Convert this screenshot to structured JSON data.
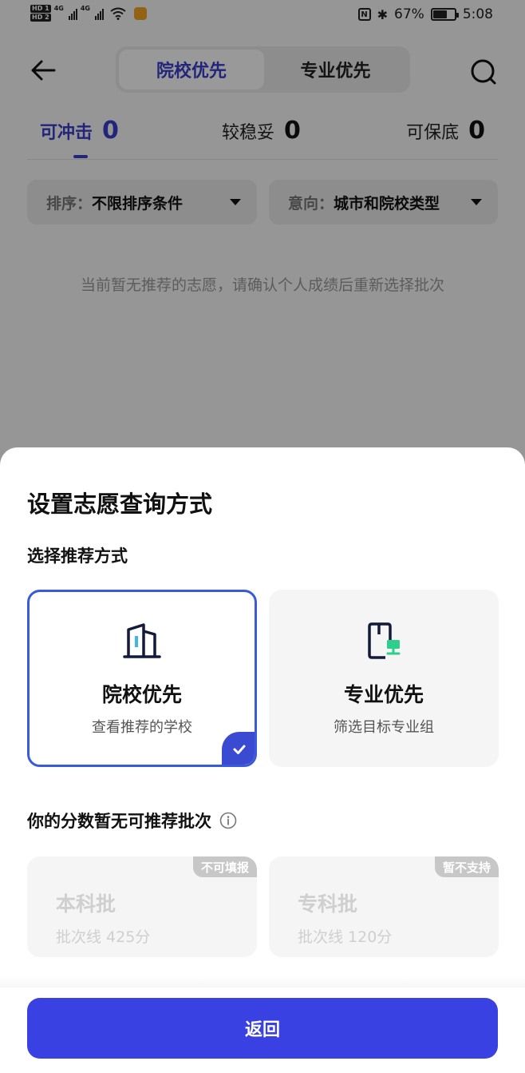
{
  "statusbar": {
    "hd1": "HD 1",
    "hd2": "HD 2",
    "net1": "4G",
    "net2": "4G",
    "battery": "67%",
    "time": "5:08",
    "battery_level": 0.67
  },
  "header": {
    "segments": [
      {
        "label": "院校优先",
        "active": true
      },
      {
        "label": "专业优先",
        "active": false
      }
    ]
  },
  "tabs": [
    {
      "label": "可冲击",
      "count": "0"
    },
    {
      "label": "较稳妥",
      "count": "0"
    },
    {
      "label": "可保底",
      "count": "0"
    }
  ],
  "filters": {
    "sort": {
      "label": "排序：",
      "value": "不限排序条件"
    },
    "intent": {
      "label": "意向：",
      "value": "城市和院校类型"
    }
  },
  "empty_message": "当前暂无推荐的志愿，请确认个人成绩后重新选择批次",
  "sheet": {
    "title": "设置志愿查询方式",
    "section1": "选择推荐方式",
    "options": [
      {
        "title": "院校优先",
        "subtitle": "查看推荐的学校",
        "selected": true,
        "icon": "building-icon"
      },
      {
        "title": "专业优先",
        "subtitle": "筛选目标专业组",
        "selected": false,
        "icon": "book-network-icon"
      }
    ],
    "section2": "你的分数暂无可推荐批次",
    "batches": [
      {
        "title": "本科批",
        "subtitle": "批次线 425分",
        "badge": "不可填报"
      },
      {
        "title": "专科批",
        "subtitle": "批次线 120分",
        "badge": "暂不支持"
      }
    ],
    "return_label": "返回"
  },
  "colors": {
    "primary": "#3a41e3",
    "accent": "#3a3ecc",
    "selected_border": "#3a5bd9",
    "icon_cyan": "#3fb6e8",
    "icon_green": "#2dd08a"
  }
}
